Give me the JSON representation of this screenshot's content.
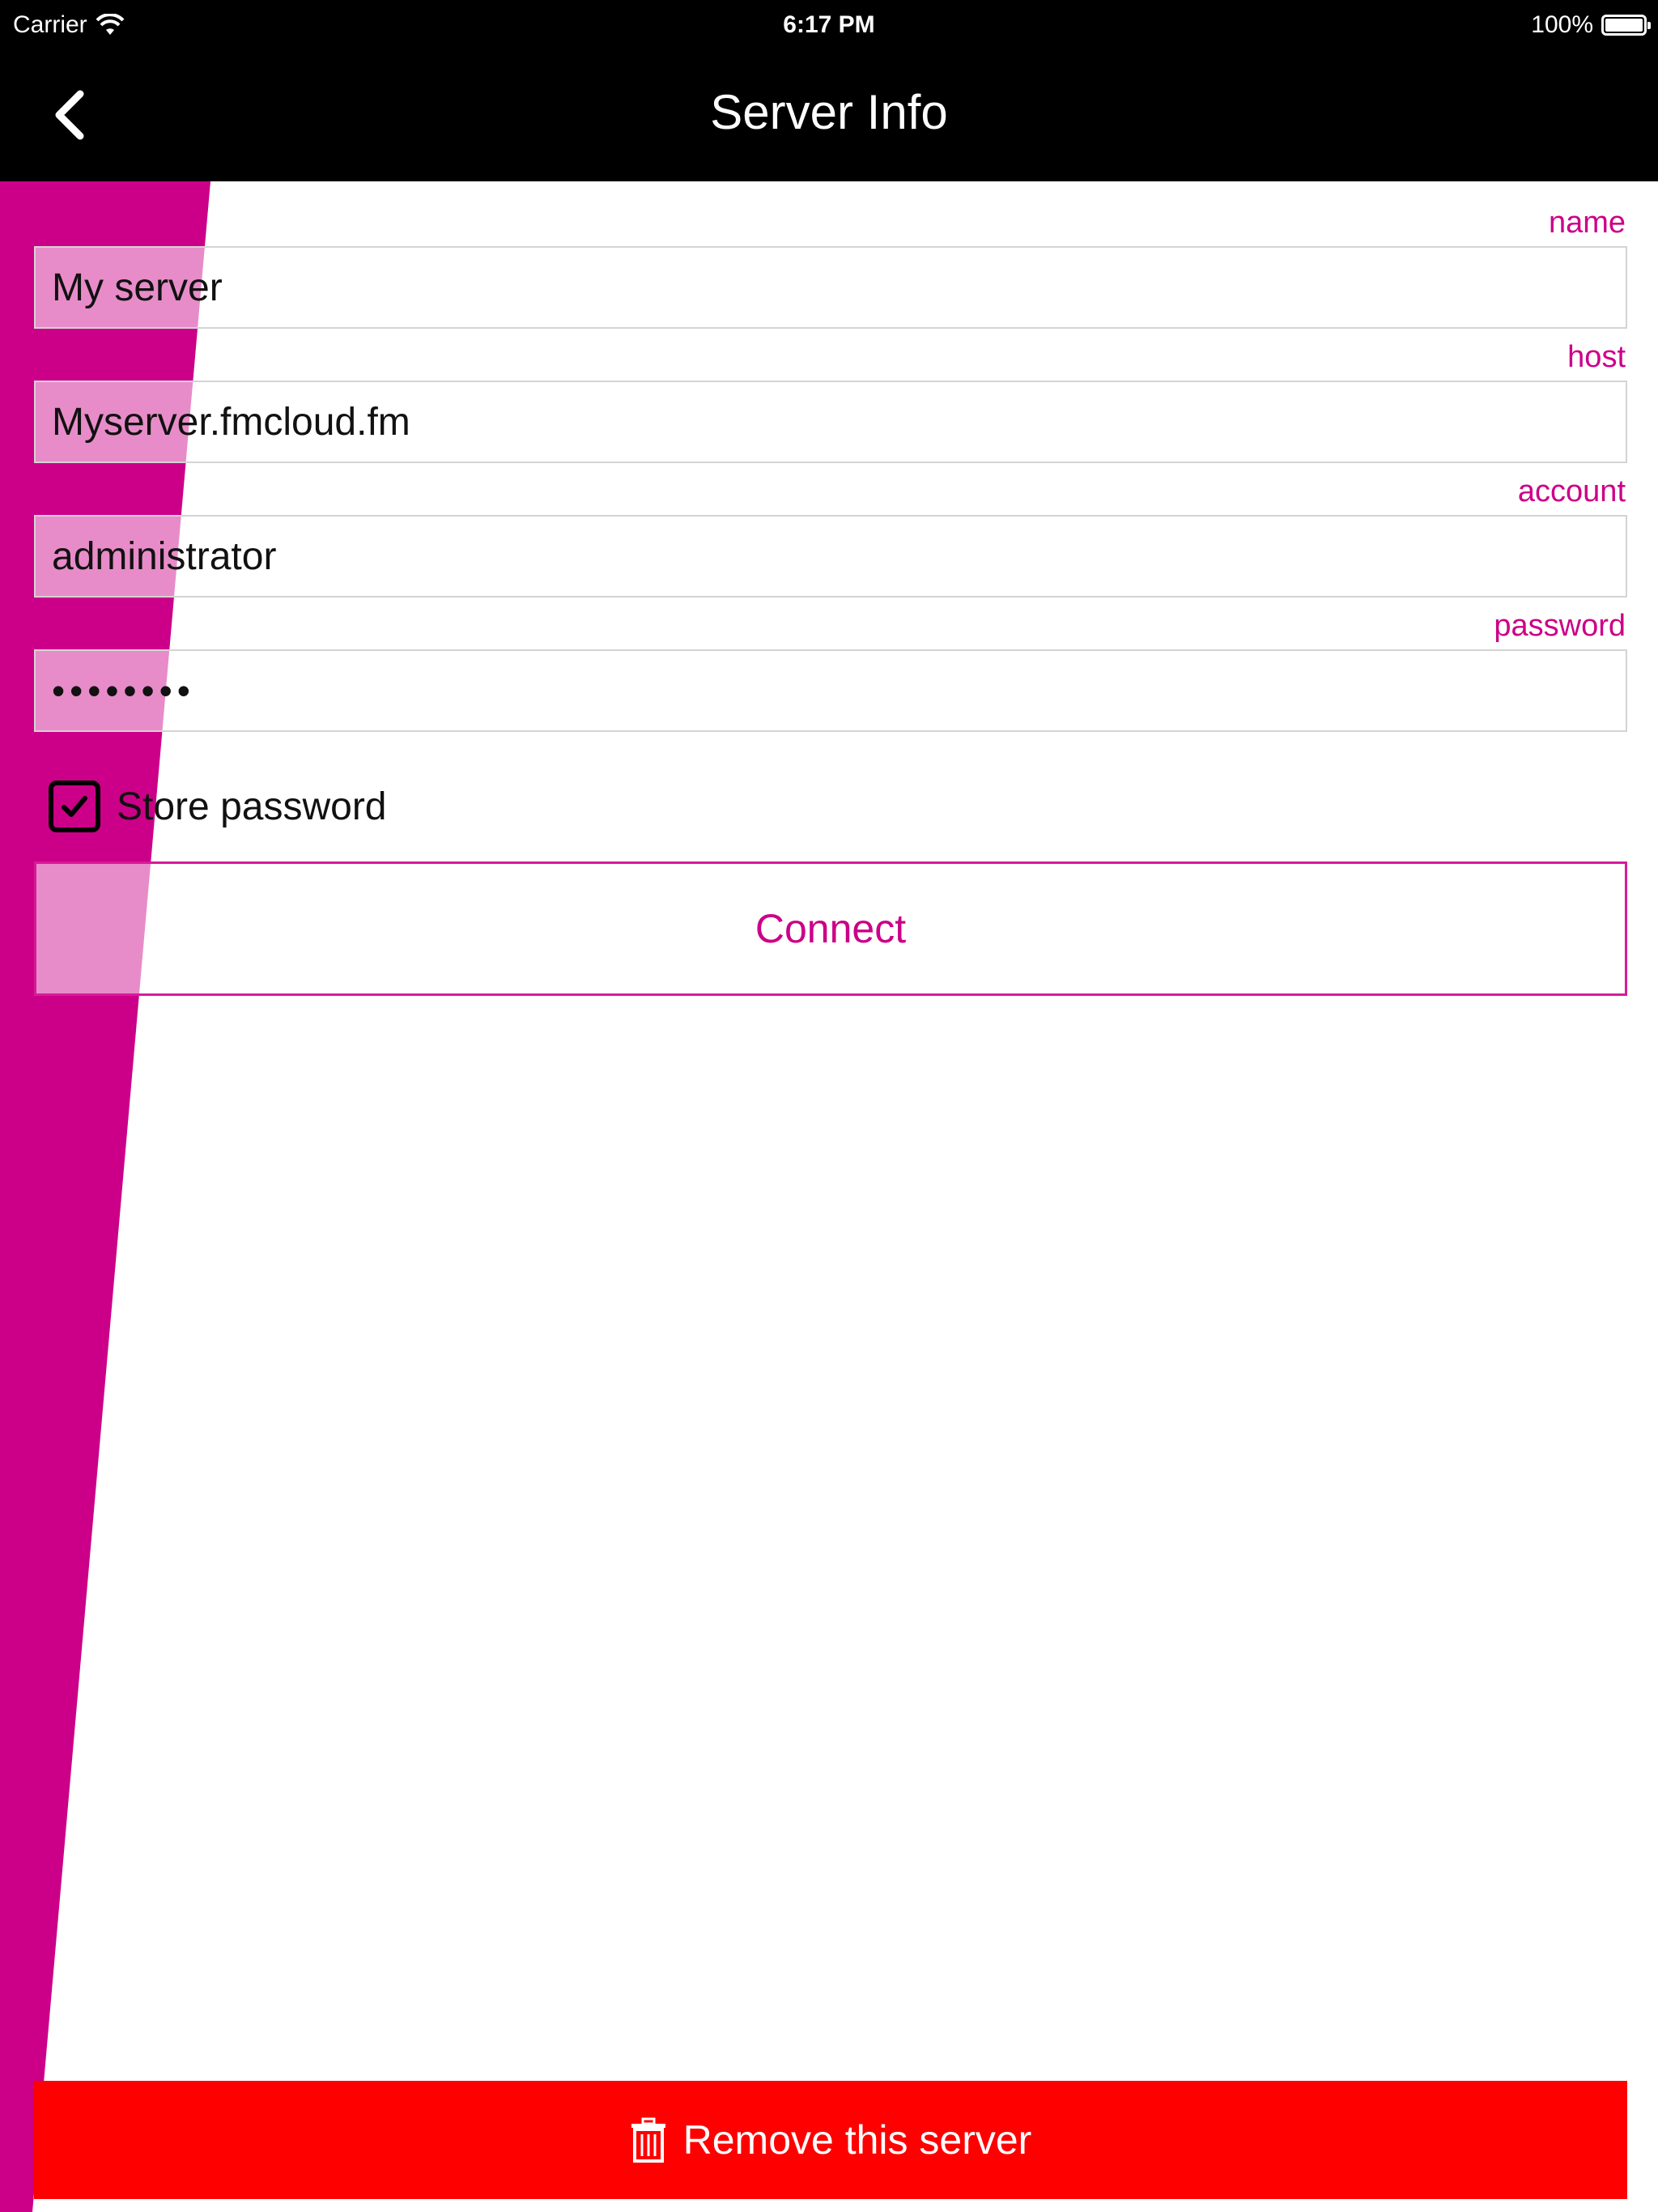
{
  "status_bar": {
    "carrier": "Carrier",
    "time": "6:17 PM",
    "battery": "100%"
  },
  "nav": {
    "title": "Server Info",
    "back_icon": "chevron-left-icon"
  },
  "form": {
    "name": {
      "label": "name",
      "value": "My server"
    },
    "host": {
      "label": "host",
      "value": "Myserver.fmcloud.fm"
    },
    "account": {
      "label": "account",
      "value": "administrator"
    },
    "password": {
      "label": "password",
      "value": "••••••••"
    },
    "store_password": {
      "label": "Store password",
      "checked": true
    }
  },
  "actions": {
    "connect_label": "Connect",
    "remove_label": "Remove this server",
    "remove_icon": "trash-icon"
  },
  "colors": {
    "accent": "#cc0088",
    "danger": "#ff0000",
    "bar": "#000000"
  }
}
